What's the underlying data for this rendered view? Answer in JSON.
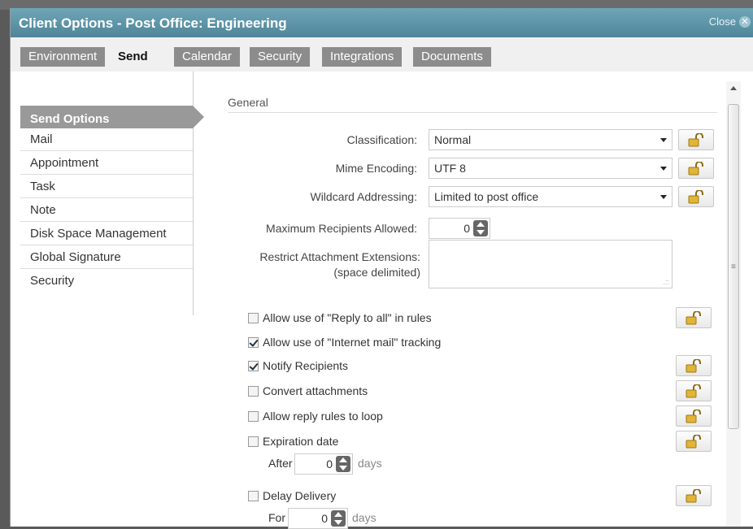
{
  "dialog": {
    "title": "Client Options - Post Office: Engineering",
    "close_label": "Close"
  },
  "tabs": [
    {
      "label": "Environment",
      "active": false
    },
    {
      "label": "Send",
      "active": true
    },
    {
      "label": "Calendar",
      "active": false
    },
    {
      "label": "Security",
      "active": false
    },
    {
      "label": "Integrations",
      "active": false
    },
    {
      "label": "Documents",
      "active": false
    }
  ],
  "sidebar": {
    "active_label": "Send Options",
    "items": [
      {
        "label": "Mail"
      },
      {
        "label": "Appointment"
      },
      {
        "label": "Task"
      },
      {
        "label": "Note"
      },
      {
        "label": "Disk Space Management"
      },
      {
        "label": "Global Signature"
      },
      {
        "label": "Security"
      }
    ]
  },
  "general": {
    "section_title": "General",
    "classification": {
      "label": "Classification:",
      "value": "Normal"
    },
    "mime_encoding": {
      "label": "Mime Encoding:",
      "value": "UTF 8"
    },
    "wildcard_addressing": {
      "label": "Wildcard Addressing:",
      "value": "Limited to post office"
    },
    "max_recipients": {
      "label": "Maximum Recipients Allowed:",
      "value": "0"
    },
    "restrict_attachments": {
      "label_line1": "Restrict Attachment Extensions:",
      "label_line2": "(space delimited)",
      "value": ""
    }
  },
  "options": [
    {
      "label": "Allow use of \"Reply to all\" in rules",
      "checked": false,
      "locked_button": true
    },
    {
      "label": "Allow use of \"Internet mail\" tracking",
      "checked": true,
      "locked_button": false
    },
    {
      "label": "Notify Recipients",
      "checked": true,
      "locked_button": true
    },
    {
      "label": "Convert attachments",
      "checked": false,
      "locked_button": true
    },
    {
      "label": "Allow reply rules to loop",
      "checked": false,
      "locked_button": true
    },
    {
      "label": "Expiration date",
      "checked": false,
      "locked_button": true
    },
    {
      "label": "Delay Delivery",
      "checked": false,
      "locked_button": true
    }
  ],
  "expiration": {
    "prefix": "After",
    "value": "0",
    "suffix": "days"
  },
  "delay": {
    "prefix": "For",
    "value": "0",
    "suffix": "days"
  },
  "icons": {
    "lock": "unlocked-padlock-icon",
    "close": "close-icon",
    "dropdown": "chevron-down-icon",
    "stepper": "spin-arrows-icon"
  }
}
